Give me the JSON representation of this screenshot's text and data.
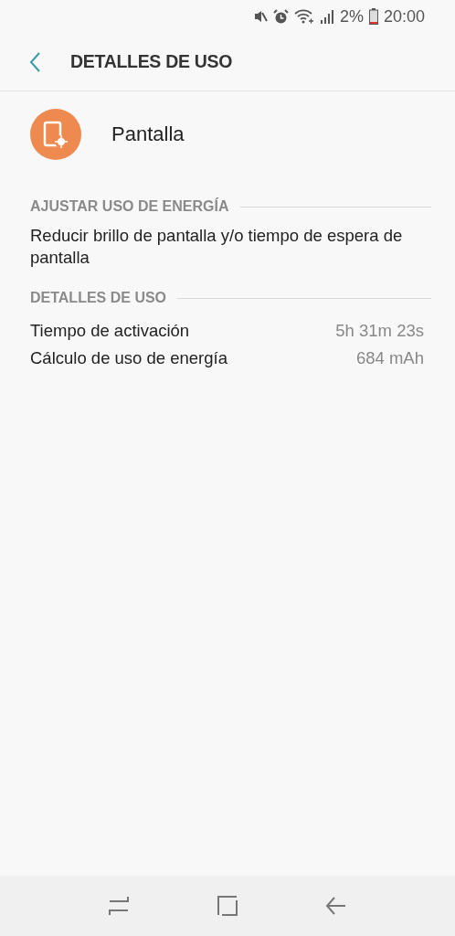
{
  "status_bar": {
    "battery": "2%",
    "time": "20:00"
  },
  "header": {
    "title": "DETALLES DE USO"
  },
  "app": {
    "name": "Pantalla"
  },
  "sections": [
    {
      "kind": "text",
      "title": "AJUSTAR USO DE ENERGÍA",
      "text": "Reducir brillo de pantalla y/o tiempo de espera de pantalla"
    },
    {
      "kind": "rows",
      "title": "DETALLES DE USO",
      "rows": [
        {
          "label": "Tiempo de activación",
          "value": "5h 31m 23s"
        },
        {
          "label": "Cálculo de uso de energía",
          "value": "684 mAh"
        }
      ]
    }
  ]
}
